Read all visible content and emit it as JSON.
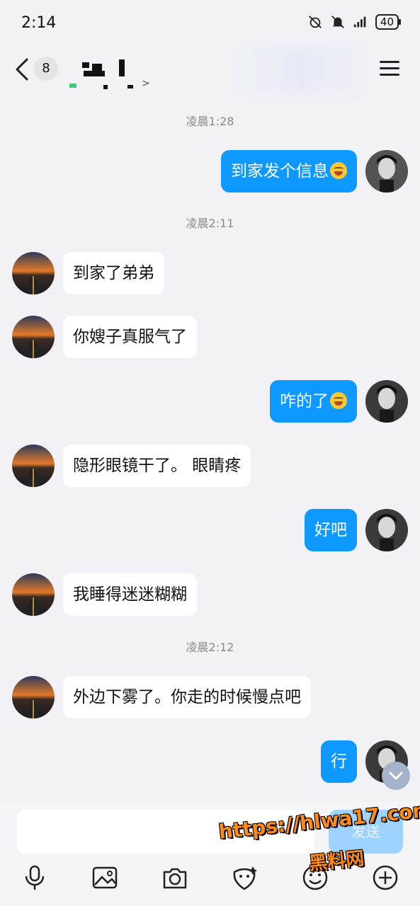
{
  "status": {
    "time": "2:14",
    "battery": "40"
  },
  "header": {
    "back_label": "<",
    "unread_count": "8",
    "name_chevron": ">"
  },
  "timestamps": [
    "凌晨1:28",
    "凌晨2:11",
    "凌晨2:12"
  ],
  "messages": [
    {
      "side": "out",
      "text": "到家发个信息",
      "emoji": true
    },
    {
      "side": "in",
      "text": "到家了弟弟"
    },
    {
      "side": "in",
      "text": "你嫂子真服气了"
    },
    {
      "side": "out",
      "text": "咋的了",
      "emoji": true
    },
    {
      "side": "in",
      "text": "隐形眼镜干了。 眼睛疼"
    },
    {
      "side": "out",
      "text": "好吧"
    },
    {
      "side": "in",
      "text": "我睡得迷迷糊糊"
    },
    {
      "side": "in",
      "text": "外边下雾了。你走的时候慢点吧"
    },
    {
      "side": "out",
      "text": "行"
    }
  ],
  "input": {
    "placeholder": "",
    "send_label": "发送"
  },
  "toolbar": [
    "microphone-icon",
    "image-icon",
    "camera-icon",
    "sticker-icon",
    "emoji-icon",
    "plus-icon"
  ],
  "watermark": {
    "line1": "https://hlwa17.com",
    "line2": "黑料网"
  },
  "colors": {
    "bubble_out": "#0d99ff",
    "bubble_in": "#ffffff",
    "background": "#f1f1f6"
  }
}
